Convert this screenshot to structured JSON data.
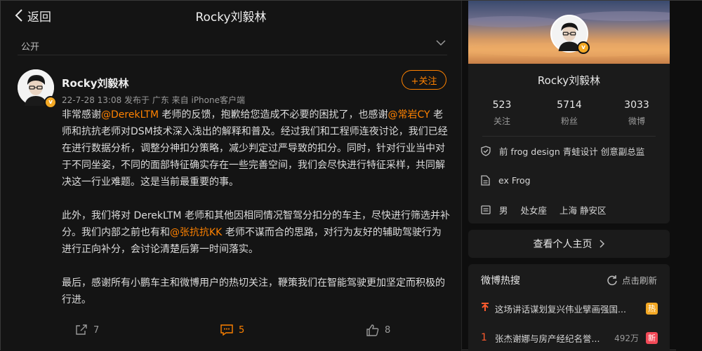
{
  "header": {
    "back_label": "返回",
    "title": "Rocky刘毅林"
  },
  "visibility": {
    "label": "公开"
  },
  "post": {
    "author": "Rocky刘毅林",
    "meta": "22-7-28 13:08  发布于 广东  来自 iPhone客户端",
    "follow_label": "+关注",
    "verified_badge": "v",
    "paragraphs": [
      [
        {
          "t": "非常感谢"
        },
        {
          "m": "@DerekLTM"
        },
        {
          "t": " 老师的反馈，抱歉给您造成不必要的困扰了，也感谢"
        },
        {
          "m": "@常岩CY"
        },
        {
          "t": " 老师和抗抗老师对DSM技术深入浅出的解释和普及。经过我们和工程师连夜讨论，我们已经在进行数据分析，调整分神扣分策略，减少判定过严导致的扣分。同时，针对行业当中对于不同坐姿，不同的面部特征确实存在一些完善空间，我们会尽快进行特征采样，共同解决这一行业难题。这是当前最重要的事。"
        }
      ],
      [
        {
          "t": "此外，我们将对 DerekLTM 老师和其他因相同情况智驾分扣分的车主，尽快进行筛选并补分。我们内部之前也有和"
        },
        {
          "m": "@张抗抗KK"
        },
        {
          "t": " 老师不谋而合的思路，对行为友好的辅助驾驶行为进行正向补分，会讨论清楚后第一时间落实。"
        }
      ],
      [
        {
          "t": "最后，感谢所有小鹏车主和微博用户的热切关注，鞭策我们在智能驾驶更加坚定而积极的行进。"
        }
      ]
    ],
    "actions": {
      "share": "7",
      "comment": "5",
      "like": "8"
    }
  },
  "profile": {
    "name": "Rocky刘毅林",
    "stats": [
      {
        "num": "523",
        "label": "关注"
      },
      {
        "num": "5714",
        "label": "粉丝"
      },
      {
        "num": "3033",
        "label": "微博"
      }
    ],
    "verification": "前 frog design 青蛙设计 创意副总监",
    "bio": "ex Frog",
    "gender": "男",
    "zodiac": "处女座",
    "location": "上海 静安区",
    "homepage_label": "查看个人主页"
  },
  "hot": {
    "title": "微博热搜",
    "refresh_label": "点击刷新",
    "items": [
      {
        "rank": "↑",
        "text": "这场讲话谋划复兴伟业擘画强国...",
        "count": "",
        "tag": "热",
        "tag_color": "#f3a824"
      },
      {
        "rank": "1",
        "text": "张杰谢娜与房产经纪名誉...",
        "count": "492万",
        "tag": "新",
        "tag_color": "#f24957"
      }
    ]
  },
  "colors": {
    "accent": "#ff8200",
    "background": "#141414",
    "card": "#1b1b1b"
  }
}
